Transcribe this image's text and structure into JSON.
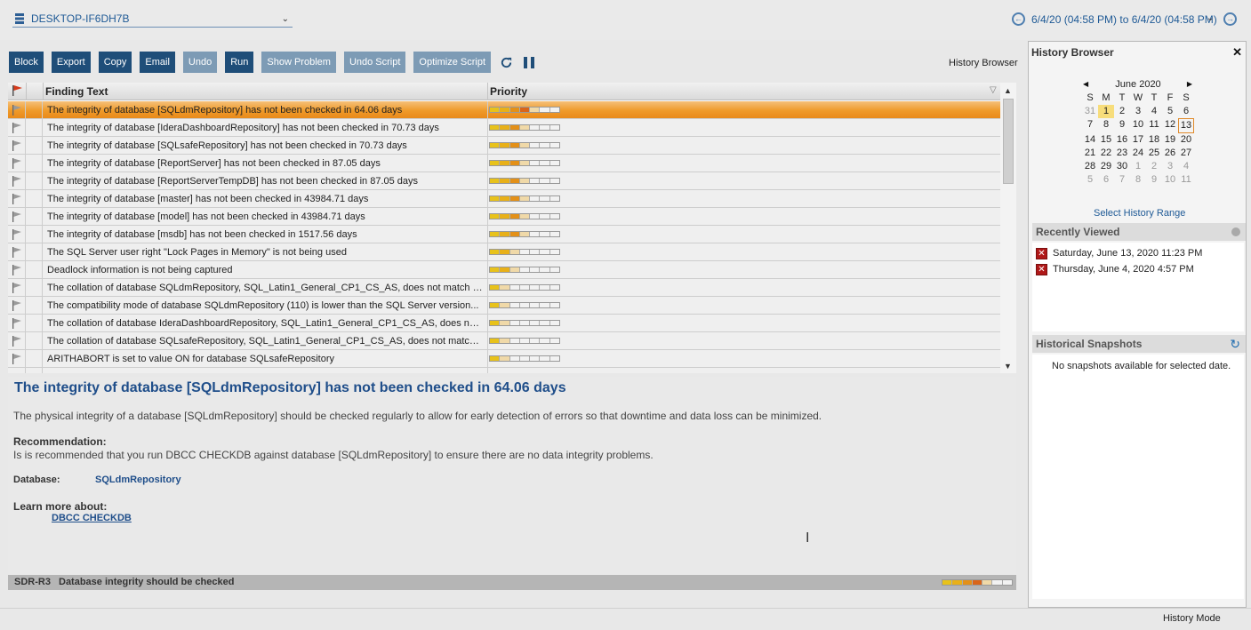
{
  "header": {
    "server_name": "DESKTOP-IF6DH7B",
    "date_range": "6/4/20 (04:58 PM) to 6/4/20 (04:58 PM)"
  },
  "toolbar": {
    "buttons": [
      "Block",
      "Export",
      "Copy",
      "Email",
      "Undo",
      "Run",
      "Show Problem",
      "Undo Script",
      "Optimize Script"
    ],
    "history_browser_link": "History Browser"
  },
  "grid": {
    "columns": {
      "finding": "Finding Text",
      "priority": "Priority"
    },
    "rows": [
      {
        "text": "The integrity of database [SQLdmRepository] has not been checked in 64.06 days",
        "priority_level": 4
      },
      {
        "text": "The integrity of database [IderaDashboardRepository] has not been checked in 70.73 days",
        "priority_level": 3
      },
      {
        "text": "The integrity of database [SQLsafeRepository] has not been checked in 70.73 days",
        "priority_level": 3
      },
      {
        "text": "The integrity of database [ReportServer] has not been checked in 87.05 days",
        "priority_level": 3
      },
      {
        "text": "The integrity of database [ReportServerTempDB] has not been checked in 87.05 days",
        "priority_level": 3
      },
      {
        "text": "The integrity of database [master] has not been checked in 43984.71 days",
        "priority_level": 3
      },
      {
        "text": "The integrity of database [model] has not been checked in 43984.71 days",
        "priority_level": 3
      },
      {
        "text": "The integrity of database [msdb] has not been checked in 1517.56 days",
        "priority_level": 3
      },
      {
        "text": "The SQL Server user right \"Lock Pages in Memory\" is not being used",
        "priority_level": 2
      },
      {
        "text": "Deadlock information is not being captured",
        "priority_level": 2
      },
      {
        "text": "The collation of database SQLdmRepository, SQL_Latin1_General_CP1_CS_AS, does not match th...",
        "priority_level": 1
      },
      {
        "text": "The compatibility mode of database SQLdmRepository (110) is lower than the SQL Server version...",
        "priority_level": 1
      },
      {
        "text": "The collation of database IderaDashboardRepository, SQL_Latin1_General_CP1_CS_AS, does not...",
        "priority_level": 1
      },
      {
        "text": "The collation of database SQLsafeRepository, SQL_Latin1_General_CP1_CS_AS, does not match th...",
        "priority_level": 1
      },
      {
        "text": "ARITHABORT is set to value ON for database SQLsafeRepository",
        "priority_level": 1
      }
    ]
  },
  "details": {
    "title": "The integrity of database [SQLdmRepository] has not been checked in 64.06 days",
    "description": "The physical integrity of a database [SQLdmRepository] should be checked regularly to allow for early detection of errors so that downtime and data loss can be minimized.",
    "recommendation_label": "Recommendation:",
    "recommendation": "Is is recommended that you run DBCC CHECKDB against database [SQLdmRepository] to ensure there are no data integrity problems.",
    "database_label": "Database:",
    "database_value": "SQLdmRepository",
    "learn_label": "Learn more about:",
    "learn_link": "DBCC CHECKDB",
    "status_code": "SDR-R3",
    "status_text": "Database integrity should be checked"
  },
  "history_browser": {
    "title": "History Browser",
    "calendar": {
      "month": "June 2020",
      "dow": [
        "S",
        "M",
        "T",
        "W",
        "T",
        "F",
        "S"
      ],
      "weeks": [
        [
          "31",
          "1",
          "2",
          "3",
          "4",
          "5",
          "6"
        ],
        [
          "7",
          "8",
          "9",
          "10",
          "11",
          "12",
          "13"
        ],
        [
          "14",
          "15",
          "16",
          "17",
          "18",
          "19",
          "20"
        ],
        [
          "21",
          "22",
          "23",
          "24",
          "25",
          "26",
          "27"
        ],
        [
          "28",
          "29",
          "30",
          "1",
          "2",
          "3",
          "4"
        ],
        [
          "5",
          "6",
          "7",
          "8",
          "9",
          "10",
          "11"
        ]
      ]
    },
    "select_range": "Select History Range",
    "recently_viewed_title": "Recently Viewed",
    "recently_viewed": [
      "Saturday, June 13, 2020 11:23 PM",
      "Thursday, June 4, 2020 4:57 PM"
    ],
    "snapshots_title": "Historical Snapshots",
    "snapshots_empty": "No snapshots available for selected date."
  },
  "footer": {
    "mode": "History Mode"
  },
  "colors": {
    "accent": "#1f4e79",
    "selected_row": "#ef9a2a",
    "link": "#1f5a96"
  }
}
